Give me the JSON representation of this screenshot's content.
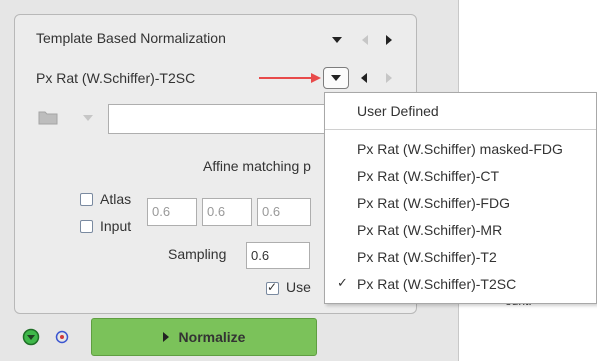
{
  "panel": {
    "title": "Template Based Normalization",
    "template_label": "Px Rat (W.Schiffer)-T2SC",
    "affine_label": "Affine matching p",
    "atlas_label": "Atlas",
    "input_label": "Input",
    "atlas_values": [
      "0.6",
      "0.6",
      "0.6"
    ],
    "sampling_label": "Sampling",
    "sampling_value": "0.6",
    "use_label": "Use",
    "use_checked": true,
    "normalize_label": "Normalize",
    "partial_text": "ount."
  },
  "menu": {
    "items": [
      {
        "label": "User Defined",
        "selected": false
      },
      {
        "label": "Px Rat (W.Schiffer) masked-FDG",
        "selected": false
      },
      {
        "label": "Px Rat (W.Schiffer)-CT",
        "selected": false
      },
      {
        "label": "Px Rat (W.Schiffer)-FDG",
        "selected": false
      },
      {
        "label": "Px Rat (W.Schiffer)-MR",
        "selected": false
      },
      {
        "label": "Px Rat (W.Schiffer)-T2",
        "selected": false
      },
      {
        "label": "Px Rat (W.Schiffer)-T2SC",
        "selected": true
      }
    ],
    "check_mark": "✓"
  },
  "colors": {
    "accent_green": "#7bc25a",
    "annotation_arrow": "#e84a4a",
    "icon_blue": "#3a55d0"
  },
  "icons": {
    "header": [
      "chevron-down-icon",
      "arrow-left-icon",
      "arrow-right-icon"
    ],
    "folder": "folder-icon",
    "bottom": [
      "green-status-icon",
      "target-icon"
    ]
  }
}
